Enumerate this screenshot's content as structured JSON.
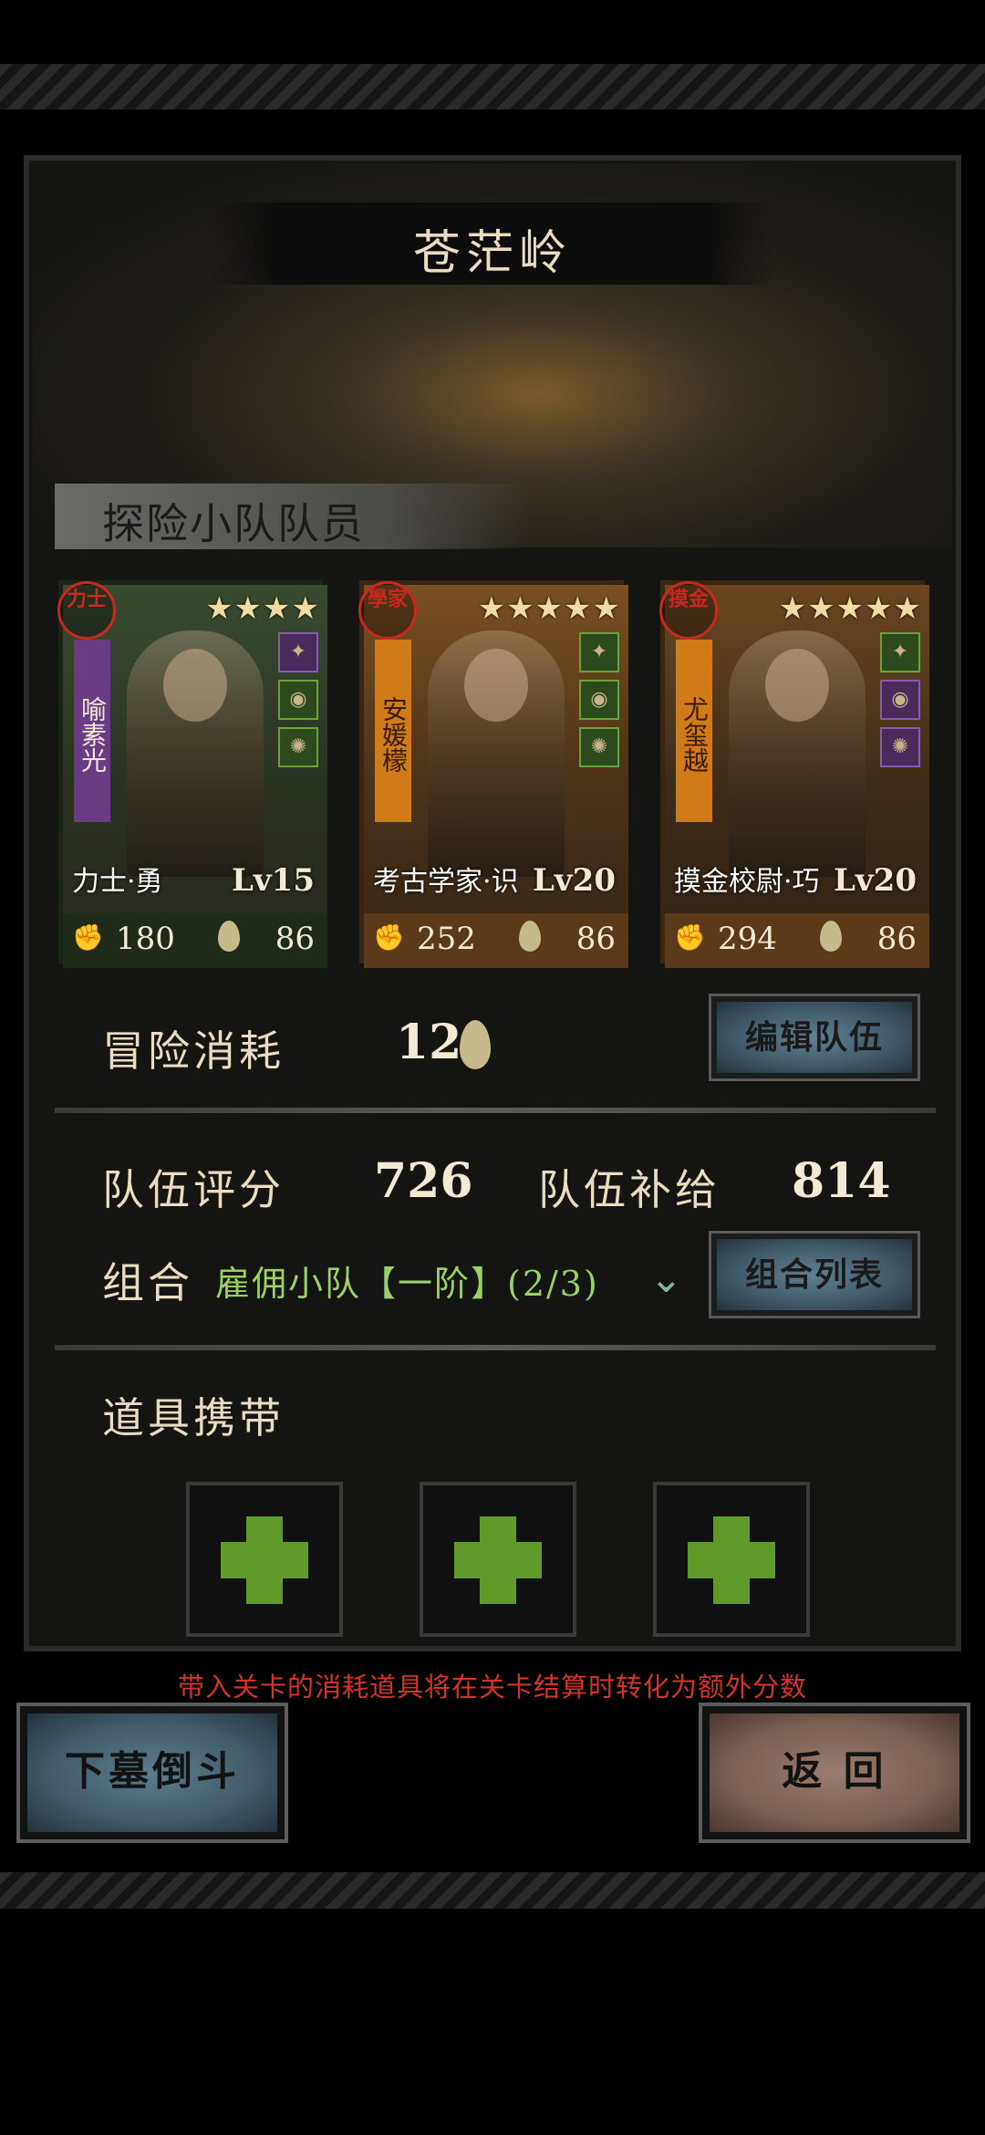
{
  "title": "苍茫岭",
  "party_label": "探险小队队员",
  "members": [
    {
      "class_seal": "力士",
      "name": "喻素光",
      "stars": "★★★★",
      "class_name": "力士·勇",
      "level": "Lv15",
      "power": "180",
      "cost": "86"
    },
    {
      "class_seal": "學家",
      "name": "安媛檬",
      "stars": "★★★★★",
      "class_name": "考古学家·识",
      "level": "Lv20",
      "power": "252",
      "cost": "86"
    },
    {
      "class_seal": "摸金",
      "name": "尤玺越",
      "stars": "★★★★★",
      "class_name": "摸金校尉·巧",
      "level": "Lv20",
      "power": "294",
      "cost": "86"
    }
  ],
  "adventure_cost_label": "冒险消耗",
  "adventure_cost_value": "12",
  "edit_team_button": "编辑队伍",
  "team_score_label": "队伍评分",
  "team_score_value": "726",
  "team_supply_label": "队伍补给",
  "team_supply_value": "814",
  "combo_label": "组合",
  "combo_value": "雇佣小队【一阶】(2/3)",
  "combo_list_button": "组合列表",
  "items_label": "道具携带",
  "items_note": "带入关卡的消耗道具将在关卡结算时转化为额外分数",
  "enter_button": "下墓倒斗",
  "back_button": "返 回",
  "colors": {
    "accent_green": "#9ccf66",
    "warning_red": "#d4332a",
    "star": "#f0dca0"
  }
}
